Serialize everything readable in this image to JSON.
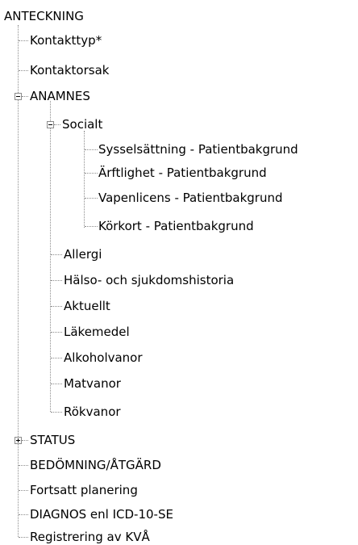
{
  "tree": {
    "root": "ANTECKNING",
    "items": {
      "kontakttyp": "Kontakttyp*",
      "kontaktorsak": "Kontaktorsak",
      "anamnes": "ANAMNES",
      "socialt": "Socialt",
      "sysselsattning": "Sysselsättning - Patientbakgrund",
      "arftlighet": "Ärftlighet - Patientbakgrund",
      "vapenlicens": "Vapenlicens - Patientbakgrund",
      "korkort": "Körkort - Patientbakgrund",
      "allergi": "Allergi",
      "halso": "Hälso- och sjukdomshistoria",
      "aktuellt": "Aktuellt",
      "lakemedel": "Läkemedel",
      "alkoholvanor": "Alkoholvanor",
      "matvanor": "Matvanor",
      "rokvanor": "Rökvanor",
      "status": "STATUS",
      "bedomning": "BEDÖMNING/ÅTGÄRD",
      "fortsatt": "Fortsatt planering",
      "diagnos": "DIAGNOS enl ICD-10-SE",
      "registrering": "Registrering av KVÅ"
    },
    "state": {
      "anamnes": "expanded",
      "socialt": "expanded",
      "status": "collapsed"
    }
  }
}
